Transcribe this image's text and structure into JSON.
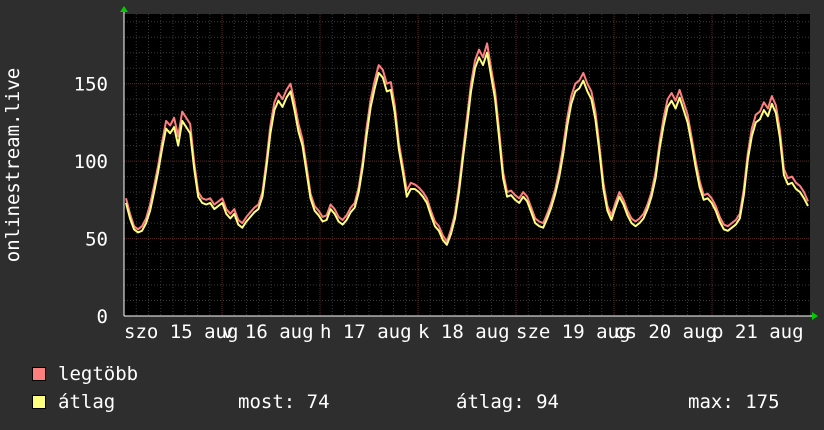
{
  "chart_data": {
    "type": "line",
    "title": "",
    "ylabel": "onlinestream.live",
    "xlabel": "",
    "ylim": [
      0,
      195
    ],
    "y_ticks": [
      0,
      50,
      100,
      150
    ],
    "x_tick_labels": [
      "szo 15 aug",
      "v 16 aug",
      "h 17 aug",
      "k 18 aug",
      "sze 19 aug",
      "cs 20 aug",
      "p 21 aug"
    ],
    "grid": true,
    "colors": {
      "background": "#000000",
      "major_grid": "#5a2a2a",
      "minor_grid": "#3a3a3a",
      "axis": "#ffffff",
      "arrow": "#00cc00"
    },
    "series": [
      {
        "name": "legtöbb",
        "color": "#ff7f7f",
        "values": [
          76,
          66,
          58,
          56,
          58,
          63,
          72,
          84,
          97,
          112,
          126,
          123,
          128,
          116,
          132,
          128,
          124,
          99,
          80,
          76,
          75,
          76,
          72,
          74,
          76,
          69,
          66,
          69,
          62,
          60,
          64,
          67,
          70,
          72,
          80,
          100,
          123,
          138,
          144,
          140,
          146,
          150,
          138,
          124,
          114,
          97,
          79,
          71,
          68,
          64,
          65,
          72,
          69,
          64,
          62,
          65,
          70,
          73,
          83,
          100,
          122,
          140,
          152,
          162,
          159,
          150,
          151,
          136,
          112,
          97,
          81,
          86,
          85,
          83,
          80,
          76,
          68,
          61,
          58,
          52,
          48,
          56,
          66,
          84,
          106,
          128,
          150,
          165,
          172,
          167,
          176,
          160,
          145,
          120,
          93,
          80,
          81,
          78,
          76,
          80,
          77,
          70,
          63,
          61,
          60,
          66,
          73,
          82,
          94,
          110,
          128,
          142,
          150,
          152,
          157,
          150,
          145,
          132,
          110,
          86,
          71,
          65,
          73,
          80,
          75,
          68,
          63,
          61,
          63,
          66,
          72,
          80,
          93,
          112,
          128,
          140,
          144,
          139,
          146,
          138,
          130,
          115,
          100,
          87,
          78,
          79,
          76,
          71,
          64,
          59,
          58,
          60,
          62,
          66,
          82,
          105,
          121,
          130,
          132,
          138,
          134,
          142,
          136,
          120,
          95,
          89,
          90,
          86,
          84,
          80,
          74
        ]
      },
      {
        "name": "átlag",
        "color": "#ffff7f",
        "values": [
          73,
          63,
          56,
          54,
          55,
          60,
          68,
          80,
          93,
          108,
          121,
          118,
          122,
          110,
          126,
          122,
          118,
          95,
          77,
          73,
          72,
          73,
          69,
          71,
          73,
          66,
          63,
          66,
          59,
          57,
          61,
          64,
          67,
          69,
          77,
          96,
          118,
          133,
          139,
          135,
          141,
          145,
          133,
          119,
          110,
          93,
          76,
          68,
          65,
          61,
          62,
          69,
          66,
          61,
          59,
          62,
          67,
          70,
          80,
          96,
          117,
          135,
          147,
          157,
          154,
          145,
          146,
          131,
          108,
          93,
          77,
          82,
          82,
          80,
          77,
          73,
          65,
          58,
          55,
          49,
          46,
          53,
          63,
          80,
          102,
          123,
          145,
          160,
          167,
          162,
          170,
          155,
          140,
          115,
          89,
          77,
          78,
          75,
          73,
          77,
          74,
          67,
          60,
          58,
          57,
          63,
          70,
          79,
          90,
          105,
          123,
          137,
          145,
          147,
          152,
          145,
          140,
          127,
          106,
          82,
          68,
          62,
          70,
          77,
          72,
          65,
          60,
          58,
          60,
          63,
          69,
          77,
          89,
          108,
          123,
          135,
          139,
          134,
          141,
          133,
          125,
          111,
          96,
          83,
          75,
          76,
          73,
          68,
          61,
          56,
          55,
          57,
          59,
          63,
          78,
          101,
          116,
          125,
          127,
          133,
          129,
          137,
          131,
          115,
          91,
          85,
          86,
          82,
          80,
          76,
          71
        ]
      }
    ]
  },
  "legend": [
    {
      "label": "legtöbb",
      "color": "#ff7f7f"
    },
    {
      "label": "átlag",
      "color": "#ffff7f"
    }
  ],
  "stats": {
    "now": "most: 74",
    "avg": "átlag: 94",
    "max": "max: 175"
  }
}
